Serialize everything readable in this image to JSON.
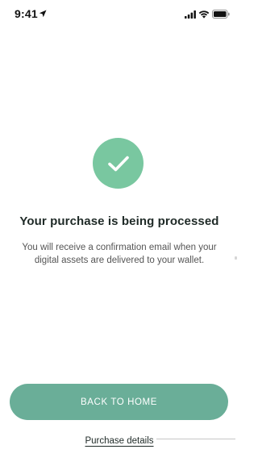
{
  "status_bar": {
    "time": "9:41",
    "icons": [
      "location-arrow-icon",
      "cellular-signal-icon",
      "wifi-icon",
      "battery-icon"
    ]
  },
  "success": {
    "icon": "checkmark-icon",
    "title": "Your purchase is being processed",
    "description": "You will receive a confirmation email when your digital assets are delivered to your wallet."
  },
  "actions": {
    "primary_label": "BACK TO HOME",
    "secondary_label": "Purchase details"
  },
  "colors": {
    "accent": "#6aae98",
    "badge": "#79c7a0",
    "text_primary": "#1f2a27",
    "text_secondary": "#555555"
  }
}
